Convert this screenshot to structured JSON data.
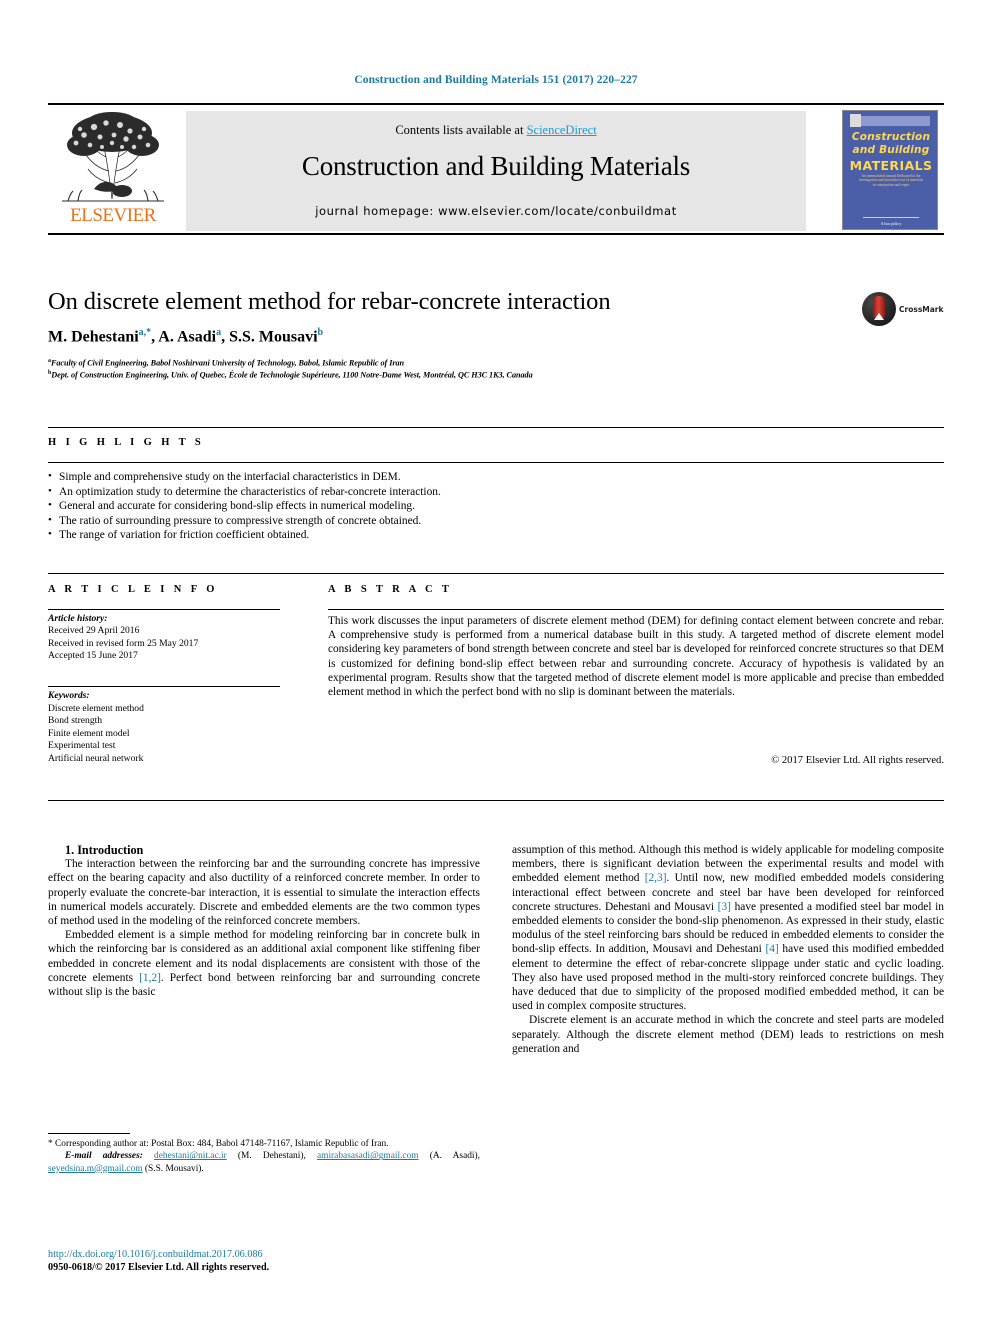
{
  "running_head": "Construction and Building Materials 151 (2017) 220–227",
  "masthead": {
    "publisher_wordmark": "ELSEVIER",
    "contents_prefix": "Contents lists available at ",
    "contents_link": "ScienceDirect",
    "journal_name": "Construction and Building Materials",
    "homepage": "journal homepage: www.elsevier.com/locate/conbuildmat",
    "cover": {
      "line1": "Construction",
      "line2": "and Building",
      "line3": "MATERIALS",
      "blurb": "An international journal Dedicated to the investigation and innovative use of materials in construction and repair",
      "foot": "A boo policy"
    }
  },
  "article": {
    "title": "On discrete element method for rebar-concrete interaction",
    "authors": [
      {
        "name": "M. Dehestani",
        "marks": "a,*"
      },
      {
        "name": "A. Asadi",
        "marks": "a"
      },
      {
        "name": "S.S. Mousavi",
        "marks": "b"
      }
    ],
    "affiliations": [
      {
        "mark": "a",
        "text": "Faculty of Civil Engineering, Babol Noshirvani University of Technology, Babol, Islamic Republic of Iran"
      },
      {
        "mark": "b",
        "text": "Dept. of Construction Engineering, Univ. of Quebec, École de Technologie Supérieure, 1100 Notre-Dame West, Montréal, QC H3C 1K3, Canada"
      }
    ],
    "crossmark_label": "CrossMark"
  },
  "highlights": {
    "heading": "H I G H L I G H T S",
    "items": [
      "Simple and comprehensive study on the interfacial characteristics in DEM.",
      "An optimization study to determine the characteristics of rebar-concrete interaction.",
      "General and accurate for considering bond-slip effects in numerical modeling.",
      "The ratio of surrounding pressure to compressive strength of concrete obtained.",
      "The range of variation for friction coefficient obtained."
    ]
  },
  "article_info": {
    "heading": "A R T I C L E    I N F O",
    "history_label": "Article history:",
    "history": [
      "Received 29 April 2016",
      "Received in revised form 25 May 2017",
      "Accepted 15 June 2017"
    ],
    "keywords_label": "Keywords:",
    "keywords": [
      "Discrete element method",
      "Bond strength",
      "Finite element model",
      "Experimental test",
      "Artificial neural network"
    ]
  },
  "abstract": {
    "heading": "A B S T R A C T",
    "text": "This work discusses the input parameters of discrete element method (DEM) for defining contact element between concrete and rebar. A comprehensive study is performed from a numerical database built in this study. A targeted method of discrete element model considering key parameters of bond strength between concrete and steel bar is developed for reinforced concrete structures so that DEM is customized for defining bond-slip effect between rebar and surrounding concrete. Accuracy of hypothesis is validated by an experimental program. Results show that the targeted method of discrete element model is more applicable and precise than embedded element method in which the perfect bond with no slip is dominant between the materials.",
    "copyright": "© 2017 Elsevier Ltd. All rights reserved."
  },
  "body": {
    "section_title": "1. Introduction",
    "left_p1": "The interaction between the reinforcing bar and the surrounding concrete has impressive effect on the bearing capacity and also ductility of a reinforced concrete member. In order to properly evaluate the concrete-bar interaction, it is essential to simulate the interaction effects in numerical models accurately. Discrete and embedded elements are the two common types of method used in the modeling of the reinforced concrete members.",
    "left_p2_a": "Embedded element is a simple method for modeling reinforcing bar in concrete bulk in which the reinforcing bar is considered as an additional axial component like stiffening fiber embedded in concrete element and its nodal displacements are consistent with those of the concrete elements ",
    "left_p2_ref": "[1,2]",
    "left_p2_b": ". Perfect bond between reinforcing bar and surrounding concrete without slip is the basic",
    "right_p1_a": "assumption of this method. Although this method is widely applicable for modeling composite members, there is significant deviation between the experimental results and model with embedded element method ",
    "right_p1_ref1": "[2,3]",
    "right_p1_b": ". Until now, new modified embedded models considering interactional effect between concrete and steel bar have been developed for reinforced concrete structures. Dehestani and Mousavi ",
    "right_p1_ref2": "[3]",
    "right_p1_c": " have presented a modified steel bar model in embedded elements to consider the bond-slip phenomenon. As expressed in their study, elastic modulus of the steel reinforcing bars should be reduced in embedded elements to consider the bond-slip effects. In addition, Mousavi and Dehestani ",
    "right_p1_ref3": "[4]",
    "right_p1_d": " have used this modified embedded element to determine the effect of rebar-concrete slippage under static and cyclic loading. They also have used proposed method in the multi-story reinforced concrete buildings. They have deduced that due to simplicity of the proposed modified embedded method, it can be used in complex composite structures.",
    "right_p2": "Discrete element is an accurate method in which the concrete and steel parts are modeled separately. Although the discrete element method (DEM) leads to restrictions on mesh generation and"
  },
  "footnotes": {
    "corresponding": "* Corresponding author at: Postal Box: 484, Babol 47148-71167, Islamic Republic of Iran.",
    "email_label": "E-mail addresses:",
    "emails": [
      {
        "address": "dehestani@nit.ac.ir",
        "owner": " (M. Dehestani), "
      },
      {
        "address": "amirabasasadi@gmail.com",
        "owner": " (A. Asadi), "
      },
      {
        "address": "seyedsina.m@gmail.com",
        "owner": " (S.S. Mousavi)."
      }
    ],
    "doi": "http://dx.doi.org/10.1016/j.conbuildmat.2017.06.086",
    "issn": "0950-0618/© 2017 Elsevier Ltd. All rights reserved."
  },
  "colors": {
    "link": "#1a7ba5",
    "sciencedirect": "#1a9bd7",
    "elsevier_orange": "#e8711a",
    "cover_blue": "#4a5fa8",
    "cover_yellow": "#ffd84d"
  }
}
